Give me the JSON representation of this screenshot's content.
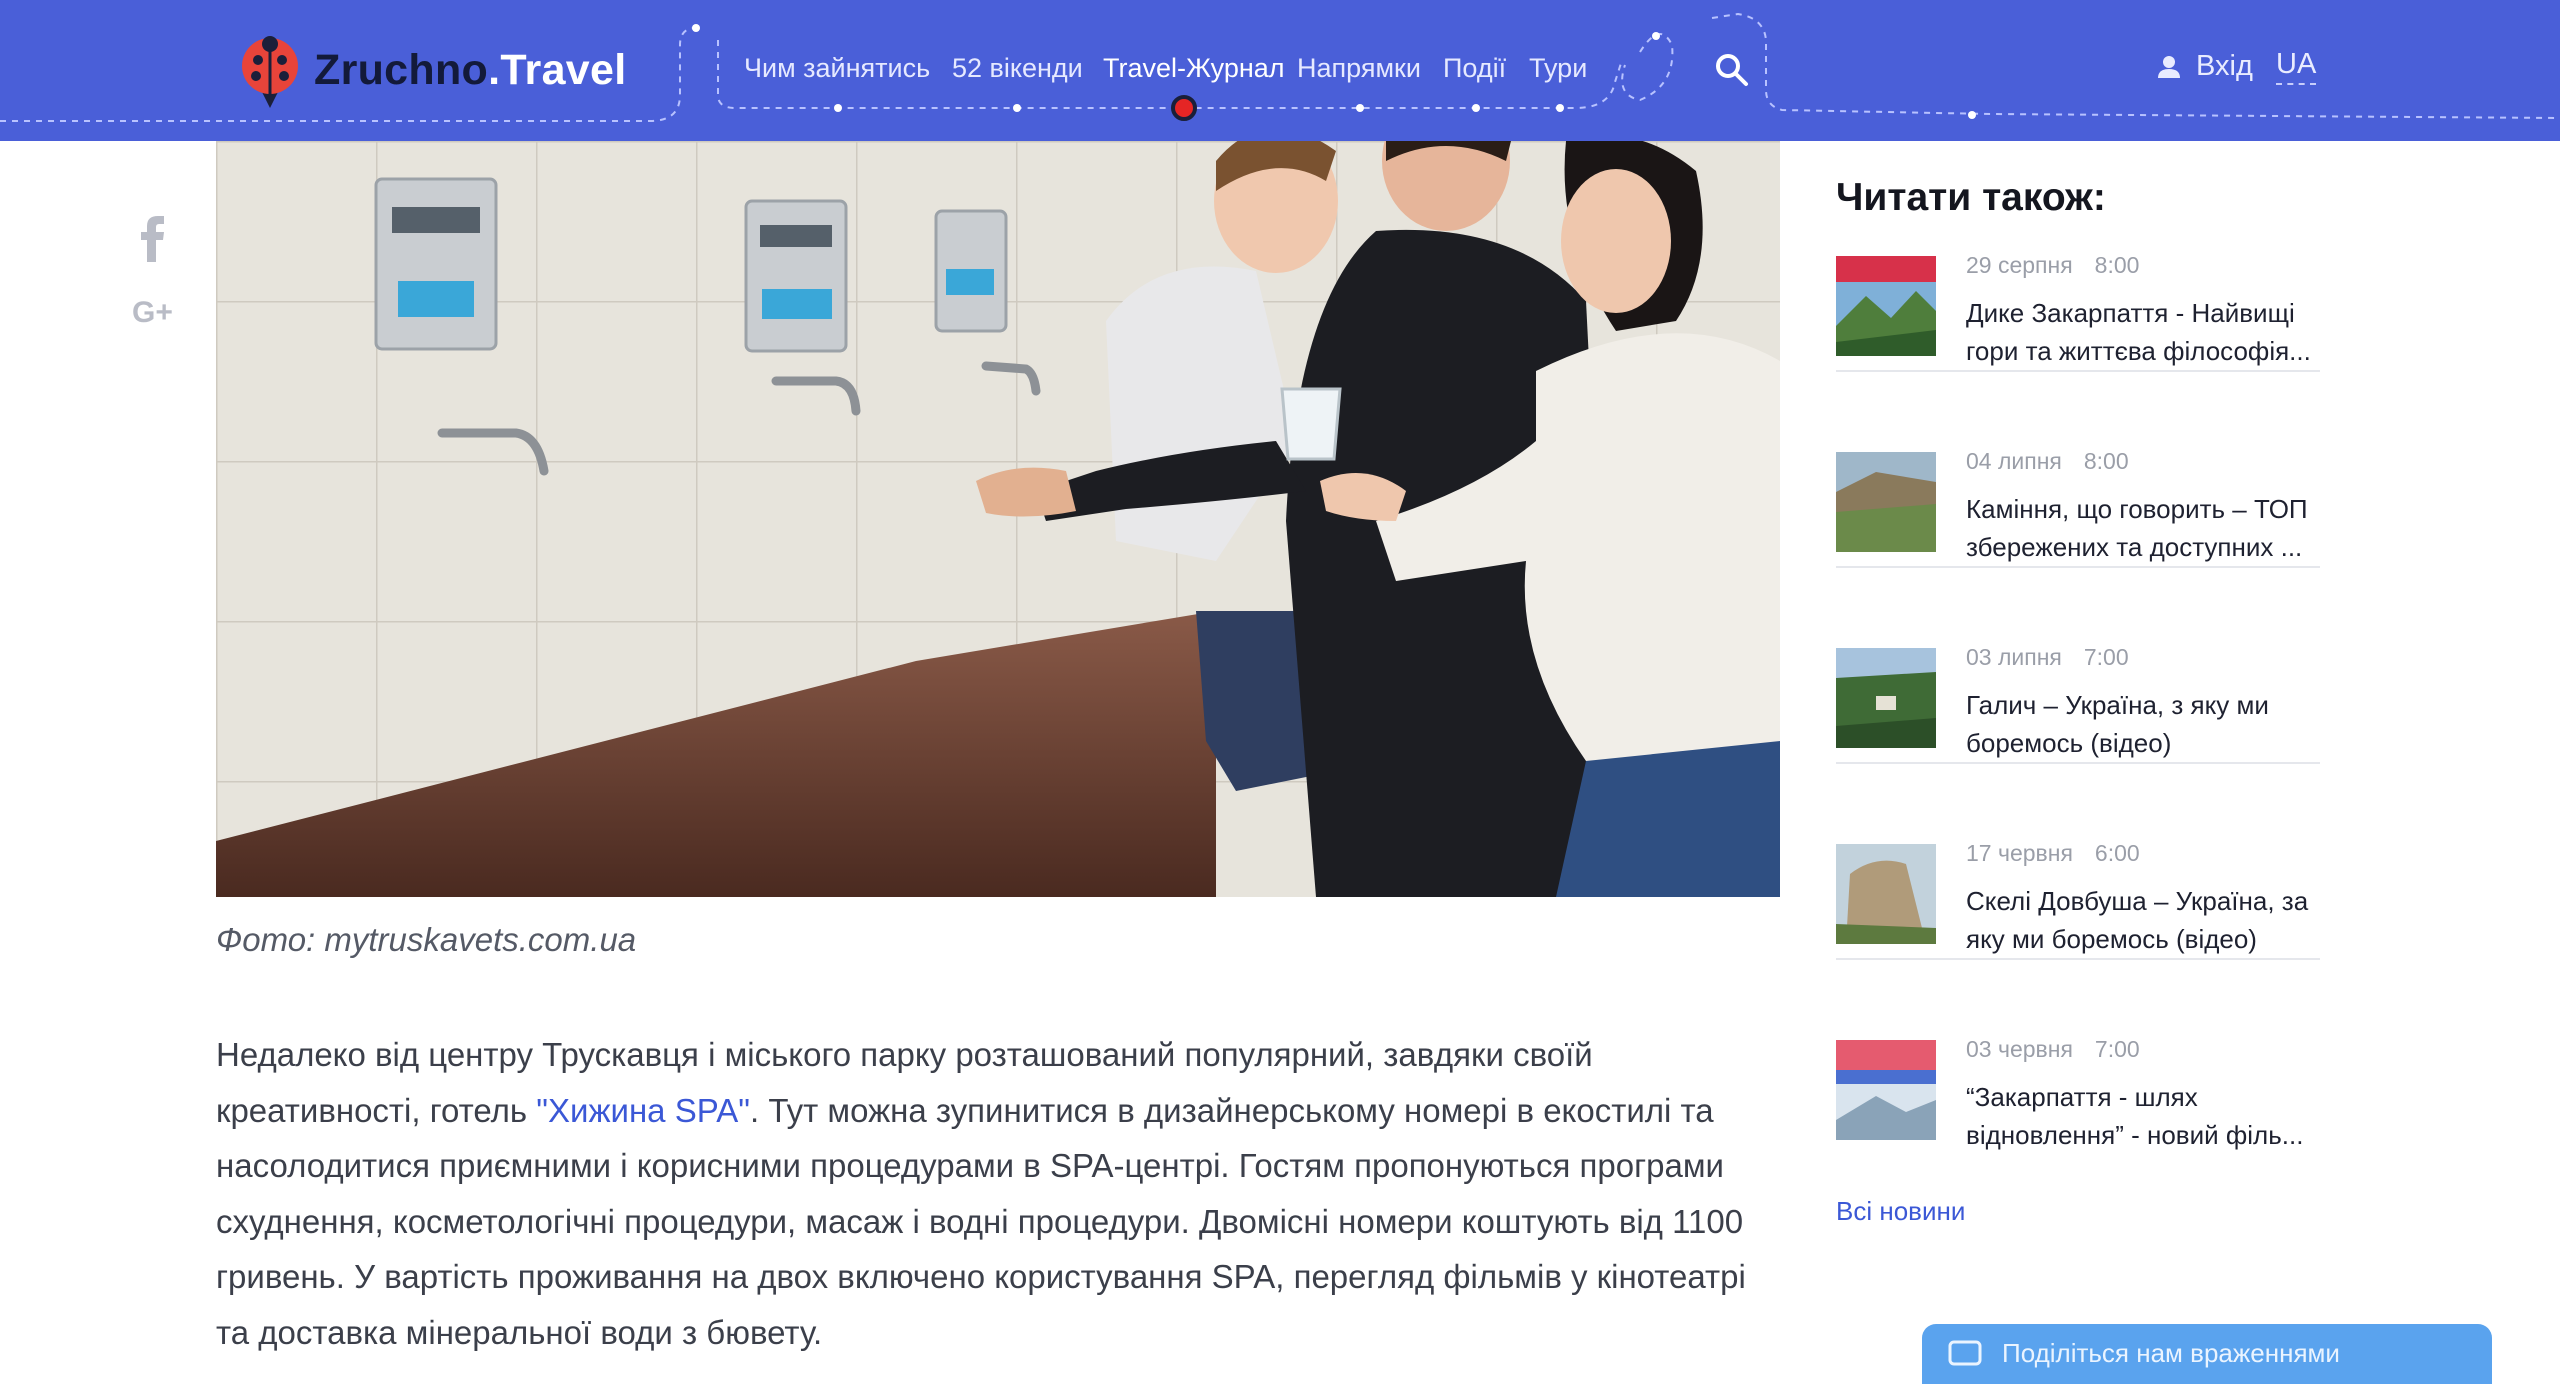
{
  "brand": {
    "name_part1": "Zruchno",
    "name_part2": ".Travel"
  },
  "nav": {
    "items": [
      {
        "label": "Чим зайнятись"
      },
      {
        "label": "52 вікенди"
      },
      {
        "label": "Travel-Журнал",
        "active": true
      },
      {
        "label": "Напрямки"
      },
      {
        "label": "Події"
      },
      {
        "label": "Тури"
      }
    ]
  },
  "header": {
    "login_label": "Вхід",
    "lang_label": "UA",
    "search_icon": "search-icon"
  },
  "colors": {
    "header_bg": "#4a5fd8",
    "accent": "#3b58d6",
    "active_dot": "#e52525",
    "promo_bg": "#5aa3ee"
  },
  "social": {
    "facebook_icon": "facebook-icon",
    "gplus_label": "G+"
  },
  "photo": {
    "caption": "Фото: mytruskavets.com.ua"
  },
  "article": {
    "p1_before": "Недалеко від центру Трускавця і міського парку розташований популярний, завдяки своїй креативності, готель ",
    "p1_link": "\"Хижина SPA\"",
    "p1_after": ". Тут можна зупинитися в дизайнерському номері в екостилі та насолодитися приємними і корисними процедурами в SPA-центрі. Гостям пропонуються програми схуднення, косметологічні процедури, масаж і водні процедури. Двомісні номери коштують від 1100 гривень. У вартість проживання на двох включено користування SPA, перегляд фільмів у кінотеатрі та доставка мінеральної води з бювету."
  },
  "sidebar": {
    "title": "Читати також:",
    "news": [
      {
        "date": "29 серпня",
        "time": "8:00",
        "title": "Дике Закарпаття - Найвищі гори та життєва філософія..."
      },
      {
        "date": "04 липня",
        "time": "8:00",
        "title": "Каміння, що говорить – ТОП збережених та доступних ..."
      },
      {
        "date": "03 липня",
        "time": "7:00",
        "title": "Галич – Україна, з яку ми боремось (відео)"
      },
      {
        "date": "17 червня",
        "time": "6:00",
        "title": "Скелі Довбуша – Україна, за яку ми боремось (відео)"
      },
      {
        "date": "03 червня",
        "time": "7:00",
        "title": "“Закарпаття - шлях відновлення” - новий філь..."
      }
    ],
    "all_news_label": "Всі новини"
  },
  "promo": {
    "text": "Поділіться нам враженнями"
  }
}
